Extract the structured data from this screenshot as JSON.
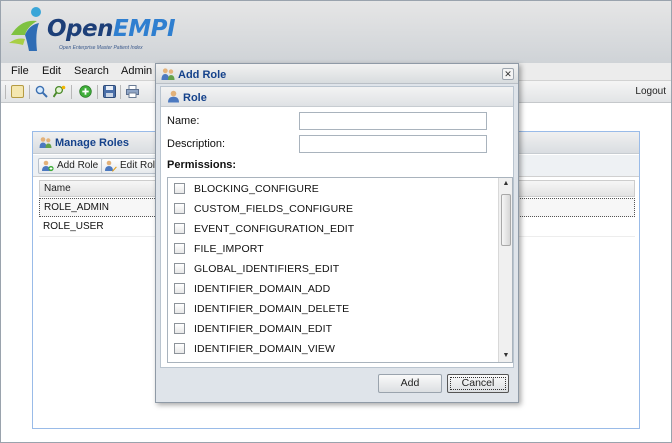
{
  "app": {
    "logo_title_main": "Open",
    "logo_title_accent": "EMPI",
    "logo_subtitle": "Open Enterprise Master Patient Index"
  },
  "menu": {
    "items": [
      "File",
      "Edit",
      "Search",
      "Admin"
    ]
  },
  "toolbar": {
    "icons": [
      "report-icon",
      "search-icon",
      "search-advanced-icon",
      "add-icon",
      "save-icon",
      "print-icon"
    ],
    "logout_label": "Logout"
  },
  "manage_roles": {
    "title": "Manage Roles",
    "buttons": {
      "add_role": "Add Role",
      "edit_role": "Edit Role"
    },
    "columns": [
      "Name"
    ],
    "rows": [
      {
        "name": "ROLE_ADMIN",
        "selected": true
      },
      {
        "name": "ROLE_USER",
        "selected": false
      }
    ]
  },
  "dialog": {
    "title": "Add Role",
    "close_glyph": "✕",
    "section_title": "Role",
    "fields": {
      "name_label": "Name:",
      "name_value": "",
      "description_label": "Description:",
      "description_value": ""
    },
    "permissions_label": "Permissions:",
    "permissions": [
      {
        "label": "BLOCKING_CONFIGURE",
        "checked": false
      },
      {
        "label": "CUSTOM_FIELDS_CONFIGURE",
        "checked": false
      },
      {
        "label": "EVENT_CONFIGURATION_EDIT",
        "checked": false
      },
      {
        "label": "FILE_IMPORT",
        "checked": false
      },
      {
        "label": "GLOBAL_IDENTIFIERS_EDIT",
        "checked": false
      },
      {
        "label": "IDENTIFIER_DOMAIN_ADD",
        "checked": false
      },
      {
        "label": "IDENTIFIER_DOMAIN_DELETE",
        "checked": false
      },
      {
        "label": "IDENTIFIER_DOMAIN_EDIT",
        "checked": false
      },
      {
        "label": "IDENTIFIER_DOMAIN_VIEW",
        "checked": false
      }
    ],
    "buttons": {
      "add": "Add",
      "cancel": "Cancel"
    }
  },
  "colors": {
    "title_blue": "#15428b",
    "logo_dark_blue": "#1d3f78",
    "logo_light_blue": "#2f7fd0",
    "panel_border": "#99bbe8"
  }
}
